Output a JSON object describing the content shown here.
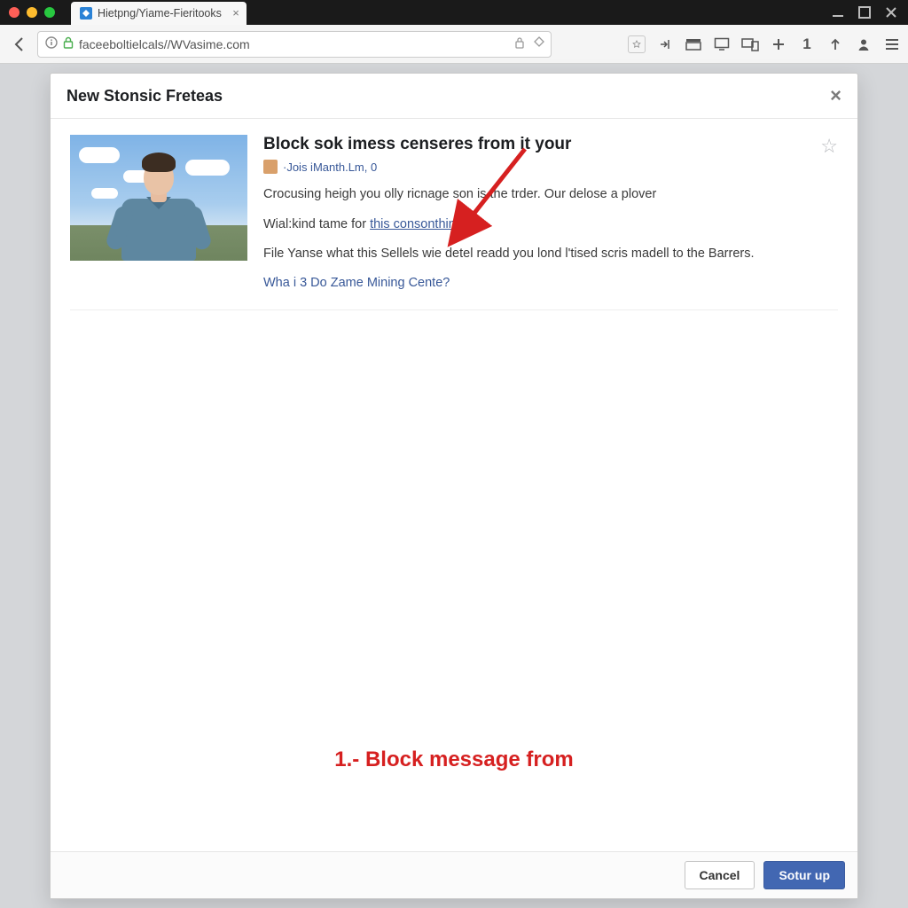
{
  "window": {
    "tab_title": "Hietpng/Yiame-Fieritooks"
  },
  "url": {
    "display": "faceeboltielcals//WVasime.com"
  },
  "dialog": {
    "title": "New Stonsic Freteas",
    "item": {
      "headline": "Block sok imess censeres from it your",
      "meta": "·Jois iManth.Lm, 0",
      "para1": "Crocusing heigh you olly ricnage son is the trder. Our delose a plover",
      "para2_prefix": "Wial:kind tame for ",
      "para2_link": "this consonthin",
      "para3": "File Yanse what this Sellels wie detel readd you lond l'tised scris madell to the Barrers.",
      "follow_link": "Wha i 3 Do Zame Mining Cente?"
    },
    "footer": {
      "cancel": "Cancel",
      "primary": "Sotur up"
    }
  },
  "annotation": {
    "caption": "1.- Block message from"
  },
  "colors": {
    "accent": "#4267b2",
    "annotation_red": "#d62020"
  }
}
